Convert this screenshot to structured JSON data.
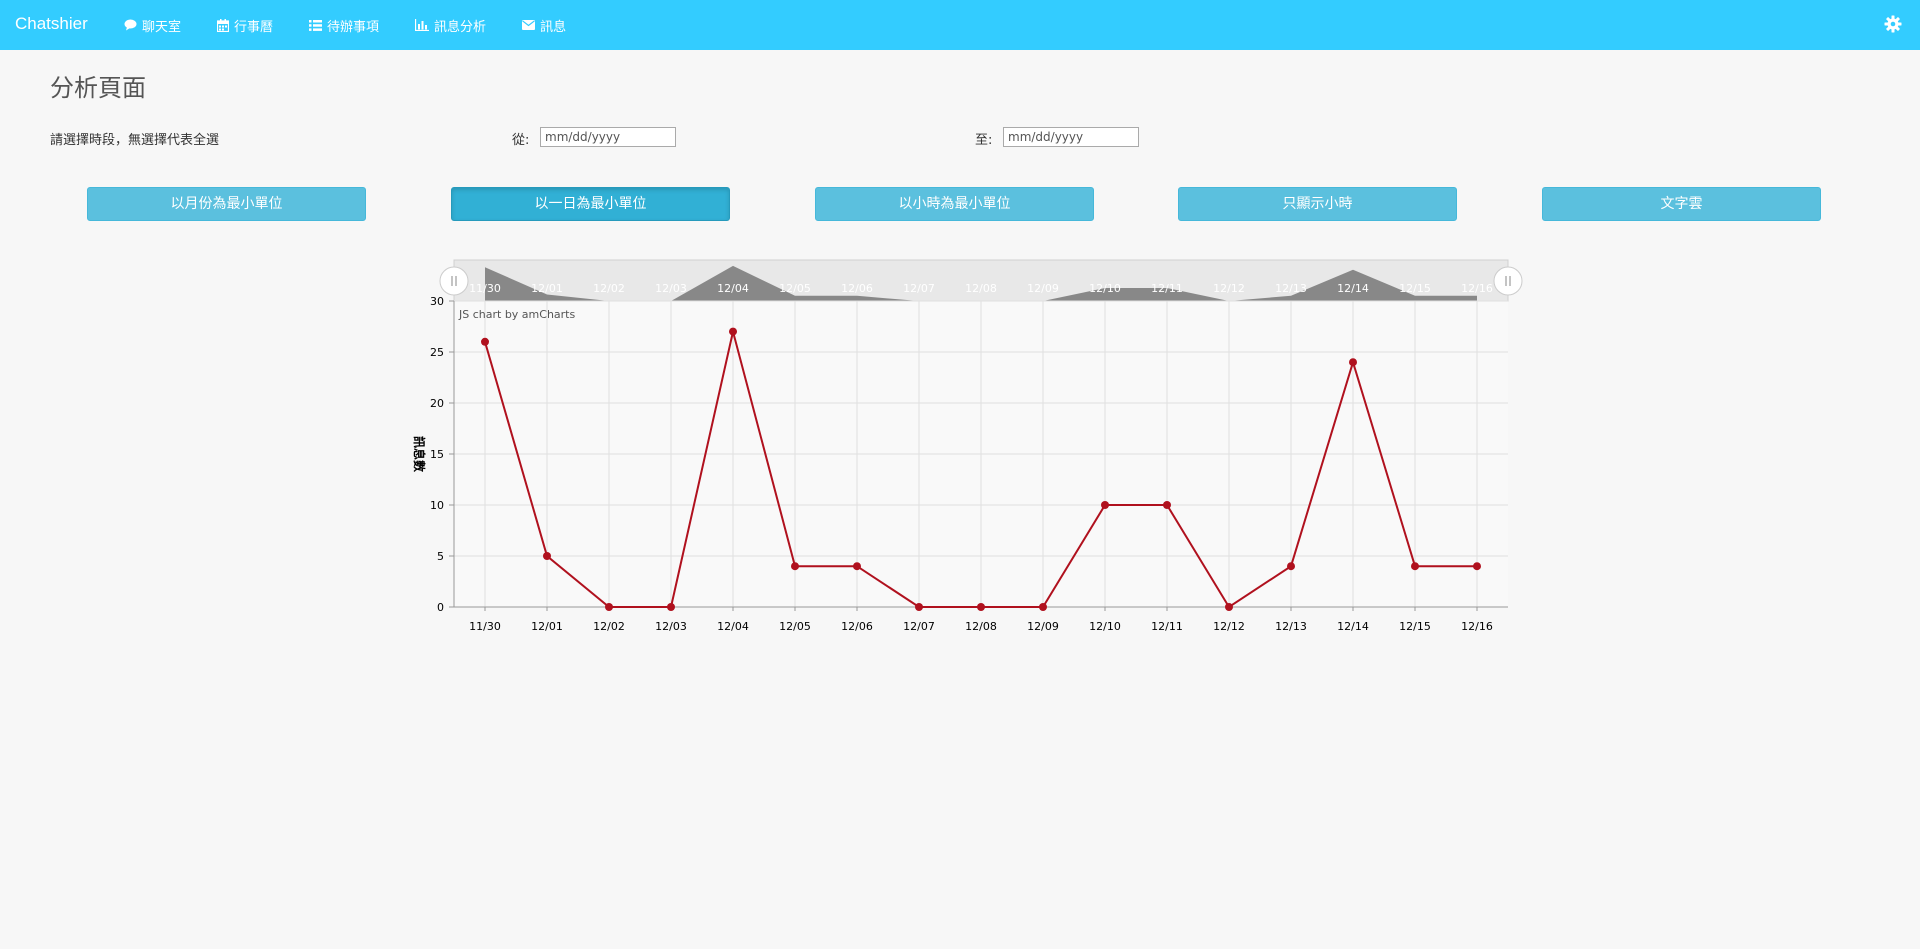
{
  "navbar": {
    "brand": "Chatshier",
    "items": [
      {
        "label": "聊天室",
        "icon": "comment-icon"
      },
      {
        "label": "行事曆",
        "icon": "calendar-icon"
      },
      {
        "label": "待辦事項",
        "icon": "list-icon"
      },
      {
        "label": "訊息分析",
        "icon": "bar-chart-icon"
      },
      {
        "label": "訊息",
        "icon": "envelope-icon"
      }
    ],
    "settings_icon": "gear-icon",
    "color": "#33ccff"
  },
  "page": {
    "title": "分析頁面",
    "hint": "請選擇時段，無選擇代表全選",
    "from_label": "從:",
    "to_label": "至:",
    "from_placeholder": "mm/dd/yyyy",
    "to_placeholder": "mm/dd/yyyy"
  },
  "buttons": [
    {
      "label": "以月份為最小單位",
      "active": false
    },
    {
      "label": "以一日為最小單位",
      "active": true
    },
    {
      "label": "以小時為最小單位",
      "active": false
    },
    {
      "label": "只顯示小時",
      "active": false
    },
    {
      "label": "文字雲",
      "active": false
    }
  ],
  "chart_data": {
    "type": "line",
    "categories": [
      "11/30",
      "12/01",
      "12/02",
      "12/03",
      "12/04",
      "12/05",
      "12/06",
      "12/07",
      "12/08",
      "12/09",
      "12/10",
      "12/11",
      "12/12",
      "12/13",
      "12/14",
      "12/15",
      "12/16"
    ],
    "values": [
      26,
      5,
      0,
      0,
      27,
      4,
      4,
      0,
      0,
      0,
      10,
      10,
      0,
      4,
      24,
      4,
      4
    ],
    "ylabel": "訊息數",
    "ylim": [
      0,
      30
    ],
    "yticks": [
      0,
      5,
      10,
      15,
      20,
      25,
      30
    ],
    "credit": "JS chart by amCharts",
    "line_color": "#b0111e",
    "scrollbar": true,
    "grid": true
  }
}
